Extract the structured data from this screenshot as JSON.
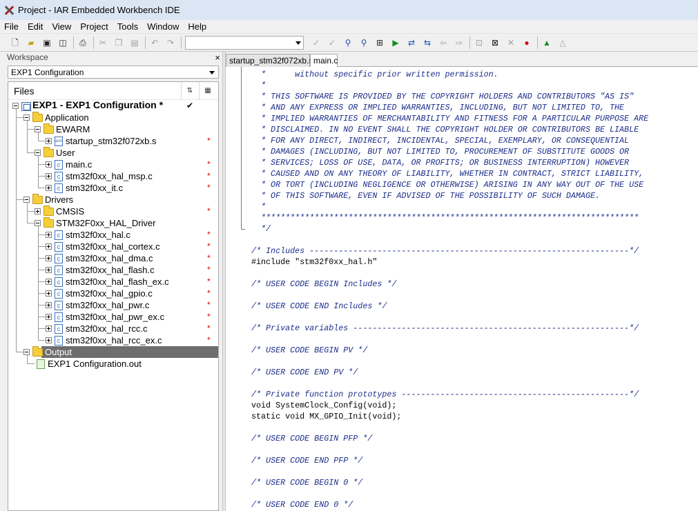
{
  "window": {
    "title": "Project - IAR Embedded Workbench IDE"
  },
  "menu": [
    "File",
    "Edit",
    "View",
    "Project",
    "Tools",
    "Window",
    "Help"
  ],
  "toolbar": {
    "icons": [
      "new-file-icon",
      "open-icon",
      "save-icon",
      "save-all-icon",
      "print-icon",
      "cut-icon",
      "copy-icon",
      "paste-icon",
      "undo-icon",
      "redo-icon",
      "find-combo",
      "toggle-bookmark-icon",
      "next-bookmark-icon",
      "find-in-files-icon",
      "find-prev-icon",
      "goto-icon",
      "navigate-forward-icon",
      "navigate-back-icon",
      "nav-icon",
      "nav2-icon",
      "compile-icon",
      "make-icon",
      "stop-build-icon",
      "breakpoint-icon",
      "debug-icon",
      "debug-without-download-icon"
    ],
    "search_value": ""
  },
  "workspace": {
    "panel_title": "Workspace",
    "configuration": "EXP1 Configuration",
    "files_header": "Files",
    "tree": [
      {
        "label": "EXP1 - EXP1 Configuration *",
        "type": "project",
        "level": 0,
        "expanded": true,
        "check": true
      },
      {
        "label": "Application",
        "type": "folder",
        "level": 1,
        "expanded": true
      },
      {
        "label": "EWARM",
        "type": "folder",
        "level": 2,
        "expanded": true
      },
      {
        "label": "startup_stm32f072xb.s",
        "type": "asm",
        "level": 3,
        "expanded": false,
        "modified": true
      },
      {
        "label": "User",
        "type": "folder",
        "level": 2,
        "expanded": true
      },
      {
        "label": "main.c",
        "type": "c",
        "level": 3,
        "expanded": false,
        "modified": true
      },
      {
        "label": "stm32f0xx_hal_msp.c",
        "type": "c",
        "level": 3,
        "expanded": false,
        "modified": true
      },
      {
        "label": "stm32f0xx_it.c",
        "type": "c",
        "level": 3,
        "expanded": false,
        "modified": true
      },
      {
        "label": "Drivers",
        "type": "folder",
        "level": 1,
        "expanded": true
      },
      {
        "label": "CMSIS",
        "type": "folder",
        "level": 2,
        "expanded": false,
        "modified": true
      },
      {
        "label": "STM32F0xx_HAL_Driver",
        "type": "folder",
        "level": 2,
        "expanded": true
      },
      {
        "label": "stm32f0xx_hal.c",
        "type": "c",
        "level": 3,
        "expanded": false,
        "modified": true
      },
      {
        "label": "stm32f0xx_hal_cortex.c",
        "type": "c",
        "level": 3,
        "expanded": false,
        "modified": true
      },
      {
        "label": "stm32f0xx_hal_dma.c",
        "type": "c",
        "level": 3,
        "expanded": false,
        "modified": true
      },
      {
        "label": "stm32f0xx_hal_flash.c",
        "type": "c",
        "level": 3,
        "expanded": false,
        "modified": true
      },
      {
        "label": "stm32f0xx_hal_flash_ex.c",
        "type": "c",
        "level": 3,
        "expanded": false,
        "modified": true
      },
      {
        "label": "stm32f0xx_hal_gpio.c",
        "type": "c",
        "level": 3,
        "expanded": false,
        "modified": true
      },
      {
        "label": "stm32f0xx_hal_pwr.c",
        "type": "c",
        "level": 3,
        "expanded": false,
        "modified": true
      },
      {
        "label": "stm32f0xx_hal_pwr_ex.c",
        "type": "c",
        "level": 3,
        "expanded": false,
        "modified": true
      },
      {
        "label": "stm32f0xx_hal_rcc.c",
        "type": "c",
        "level": 3,
        "expanded": false,
        "modified": true
      },
      {
        "label": "stm32f0xx_hal_rcc_ex.c",
        "type": "c",
        "level": 3,
        "expanded": false,
        "modified": true
      },
      {
        "label": "Output",
        "type": "folder",
        "level": 1,
        "expanded": true,
        "selected": true
      },
      {
        "label": "EXP1 Configuration.out",
        "type": "out",
        "level": 2,
        "expanded": false
      }
    ],
    "modified_mark": "*",
    "check_mark": "✔"
  },
  "editor": {
    "tabs": [
      {
        "label": "startup_stm32f072xb.s",
        "active": false
      },
      {
        "label": "main.c",
        "active": true
      }
    ],
    "lines": [
      {
        "text": "  *      without specific prior written permission.",
        "kind": "cm"
      },
      {
        "text": "  *",
        "kind": "cm"
      },
      {
        "text": "  * THIS SOFTWARE IS PROVIDED BY THE COPYRIGHT HOLDERS AND CONTRIBUTORS \"AS IS\"",
        "kind": "cm"
      },
      {
        "text": "  * AND ANY EXPRESS OR IMPLIED WARRANTIES, INCLUDING, BUT NOT LIMITED TO, THE",
        "kind": "cm"
      },
      {
        "text": "  * IMPLIED WARRANTIES OF MERCHANTABILITY AND FITNESS FOR A PARTICULAR PURPOSE ARE",
        "kind": "cm"
      },
      {
        "text": "  * DISCLAIMED. IN NO EVENT SHALL THE COPYRIGHT HOLDER OR CONTRIBUTORS BE LIABLE",
        "kind": "cm"
      },
      {
        "text": "  * FOR ANY DIRECT, INDIRECT, INCIDENTAL, SPECIAL, EXEMPLARY, OR CONSEQUENTIAL",
        "kind": "cm"
      },
      {
        "text": "  * DAMAGES (INCLUDING, BUT NOT LIMITED TO, PROCUREMENT OF SUBSTITUTE GOODS OR",
        "kind": "cm"
      },
      {
        "text": "  * SERVICES; LOSS OF USE, DATA, OR PROFITS; OR BUSINESS INTERRUPTION) HOWEVER",
        "kind": "cm"
      },
      {
        "text": "  * CAUSED AND ON ANY THEORY OF LIABILITY, WHETHER IN CONTRACT, STRICT LIABILITY,",
        "kind": "cm"
      },
      {
        "text": "  * OR TORT (INCLUDING NEGLIGENCE OR OTHERWISE) ARISING IN ANY WAY OUT OF THE USE",
        "kind": "cm"
      },
      {
        "text": "  * OF THIS SOFTWARE, EVEN IF ADVISED OF THE POSSIBILITY OF SUCH DAMAGE.",
        "kind": "cm"
      },
      {
        "text": "  *",
        "kind": "cm"
      },
      {
        "text": "  ******************************************************************************",
        "kind": "cm"
      },
      {
        "text": "  */",
        "kind": "cm"
      },
      {
        "text": "",
        "kind": "kw"
      },
      {
        "text": "/* Includes ------------------------------------------------------------------*/",
        "kind": "cm"
      },
      {
        "text": "#include \"stm32f0xx_hal.h\"",
        "kind": "kw"
      },
      {
        "text": "",
        "kind": "kw"
      },
      {
        "text": "/* USER CODE BEGIN Includes */",
        "kind": "cm"
      },
      {
        "text": "",
        "kind": "kw"
      },
      {
        "text": "/* USER CODE END Includes */",
        "kind": "cm"
      },
      {
        "text": "",
        "kind": "kw"
      },
      {
        "text": "/* Private variables ---------------------------------------------------------*/",
        "kind": "cm"
      },
      {
        "text": "",
        "kind": "kw"
      },
      {
        "text": "/* USER CODE BEGIN PV */",
        "kind": "cm"
      },
      {
        "text": "",
        "kind": "kw"
      },
      {
        "text": "/* USER CODE END PV */",
        "kind": "cm"
      },
      {
        "text": "",
        "kind": "kw"
      },
      {
        "text": "/* Private function prototypes -----------------------------------------------*/",
        "kind": "cm"
      },
      {
        "text": "void SystemClock_Config(void);",
        "kind": "kw"
      },
      {
        "text": "static void MX_GPIO_Init(void);",
        "kind": "kw"
      },
      {
        "text": "",
        "kind": "kw"
      },
      {
        "text": "/* USER CODE BEGIN PFP */",
        "kind": "cm"
      },
      {
        "text": "",
        "kind": "kw"
      },
      {
        "text": "/* USER CODE END PFP */",
        "kind": "cm"
      },
      {
        "text": "",
        "kind": "kw"
      },
      {
        "text": "/* USER CODE BEGIN 0 */",
        "kind": "cm"
      },
      {
        "text": "",
        "kind": "kw"
      },
      {
        "text": "/* USER CODE END 0 */",
        "kind": "cm"
      }
    ]
  },
  "colors": {
    "comment": "#1b2d8a",
    "modified": "#e00000",
    "selection": "#6e6e6e",
    "titlebar": "#dbe6f4"
  }
}
